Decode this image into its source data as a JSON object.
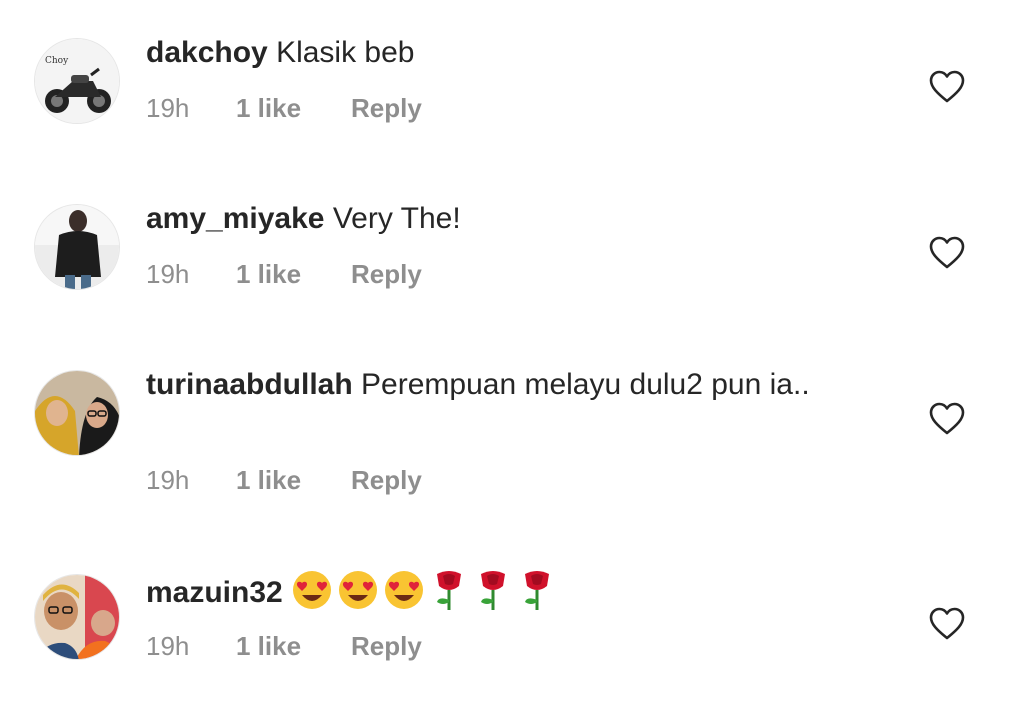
{
  "comments": [
    {
      "username": "dakchoy",
      "text": "Klasik beb",
      "time": "19h",
      "likes": "1 like",
      "reply_label": "Reply",
      "avatar_caption": "Choy"
    },
    {
      "username": "amy_miyake",
      "text": "Very The!",
      "time": "19h",
      "likes": "1 like",
      "reply_label": "Reply"
    },
    {
      "username": "turinaabdullah",
      "text": "Perempuan melayu dulu2 pun ia..",
      "time": "19h",
      "likes": "1 like",
      "reply_label": "Reply"
    },
    {
      "username": "mazuin32",
      "text": "",
      "emojis": [
        "heart-eyes-emoji",
        "heart-eyes-emoji",
        "heart-eyes-emoji",
        "rose-emoji",
        "rose-emoji",
        "rose-emoji"
      ],
      "time": "19h",
      "likes": "1 like",
      "reply_label": "Reply"
    }
  ],
  "icons": {
    "like": "heart-outline-icon"
  },
  "colors": {
    "text": "#262626",
    "meta": "#8e8e8e",
    "icon": "#262626"
  }
}
